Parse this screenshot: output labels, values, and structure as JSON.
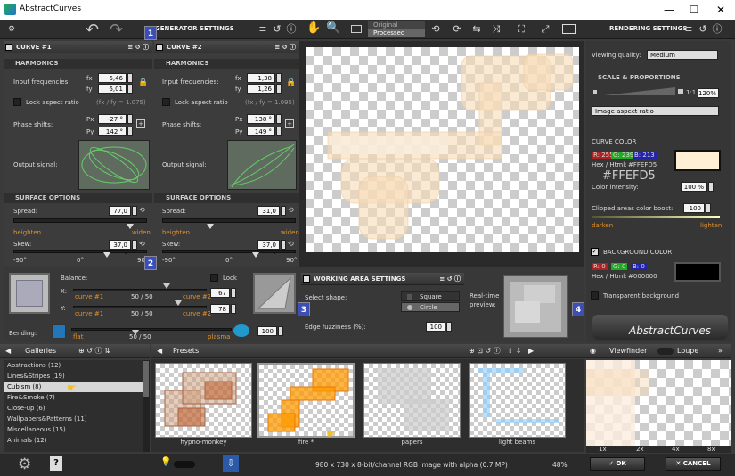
{
  "window": {
    "title": "AbstractCurves",
    "minimize": "—",
    "maximize": "☐",
    "close": "✕"
  },
  "toolbar": {
    "generator_settings": "GENERATOR SETTINGS",
    "original": "Original",
    "processed": "Processed",
    "rendering_settings": "RENDERING SETTINGS"
  },
  "curve1": {
    "title": "CURVE #1",
    "harmonics": "HARMONICS",
    "input_freq": "Input frequencies:",
    "fx_label": "fx",
    "fy_label": "fy",
    "fx": "6,46",
    "fy": "6,01",
    "lock_aspect": "Lock aspect ratio",
    "ratio": "(fx / fy = 1.075)",
    "phase_shifts": "Phase shifts:",
    "px_label": "Px",
    "py_label": "Py",
    "px": "-27 °",
    "py": "142 °",
    "output_signal": "Output signal:",
    "surface": "SURFACE OPTIONS",
    "spread": "Spread:",
    "spread_val": "77,0",
    "heighten": "heighten",
    "widen": "widen",
    "skew": "Skew:",
    "skew_val": "37,0 °",
    "t1": "-90°",
    "t2": "0°",
    "t3": "90°"
  },
  "curve2": {
    "title": "CURVE #2",
    "harmonics": "HARMONICS",
    "input_freq": "Input frequencies:",
    "fx_label": "fx",
    "fy_label": "fy",
    "fx": "1,38",
    "fy": "1,26",
    "lock_aspect": "Lock aspect ratio",
    "ratio": "(fx / fy = 1.095)",
    "phase_shifts": "Phase shifts:",
    "px_label": "Px",
    "py_label": "Py",
    "px": "138 °",
    "py": "149 °",
    "output_signal": "Output signal:",
    "surface": "SURFACE OPTIONS",
    "spread": "Spread:",
    "spread_val": "31,0",
    "heighten": "heighten",
    "widen": "widen",
    "skew": "Skew:",
    "skew_val": "37,0 °",
    "t1": "-90°",
    "t2": "0°",
    "t3": "90°"
  },
  "balance": {
    "label": "Balance:",
    "lock": "Lock",
    "x_label": "X:",
    "y_label": "Y:",
    "curve1": "curve #1",
    "curve2": "curve #2",
    "x_mid": "50 / 50",
    "y_mid": "50 / 50",
    "x_val": "67",
    "y_val": "78",
    "bending": "Bending:",
    "flat": "flat",
    "bend_mid": "50 / 50",
    "plasma": "plasma",
    "bend_val": "100"
  },
  "working": {
    "title": "WORKING AREA SETTINGS",
    "select_shape": "Select shape:",
    "square": "Square",
    "circle": "Circle",
    "edge": "Edge fuzziness (%):",
    "edge_val": "100",
    "realtime": "Real-time preview:"
  },
  "rendering": {
    "viewing_quality": "Viewing quality:",
    "quality_val": "Medium",
    "scale": "SCALE & PROPORTIONS",
    "one_to_one": "1:1",
    "zoom": "120%",
    "aspect": "Image aspect ratio",
    "curve_color": "CURVE COLOR",
    "r": "R: 255",
    "g": "G: 239",
    "b": "B: 213",
    "hex_label": "Hex / Html:",
    "hex": "#FFEFD5",
    "hex_big": "#FFEFD5",
    "intensity": "Color intensity:",
    "intensity_val": "100 %",
    "clipped": "Clipped areas color boost:",
    "clipped_val": "100",
    "darken": "darken",
    "lighten": "lighten",
    "bg_color": "BACKGROUND COLOR",
    "bg_r": "R: 0",
    "bg_g": "G: 0",
    "bg_b": "B: 0",
    "bg_hex_label": "Hex / Html:",
    "bg_hex": "#000000",
    "transparent": "Transparent background",
    "logo": "AbstractCurves"
  },
  "galleries": {
    "title": "Galleries",
    "items": [
      "Abstractions (12)",
      "Lines&Stripes (19)",
      "Cubism (8)",
      "Fire&Smoke (7)",
      "Close-up (6)",
      "Wallpapers&Patterns (11)",
      "Miscellaneous (15)",
      "Animals (12)"
    ]
  },
  "presets": {
    "title": "Presets",
    "items": [
      "hypno-monkey",
      "fire *",
      "papers",
      "light beams"
    ]
  },
  "viewfinder": {
    "title": "Viewfinder",
    "loupe": "Loupe",
    "zooms": [
      "1x",
      "2x",
      "4x",
      "8x"
    ]
  },
  "badges": [
    "1",
    "2",
    "3",
    "4"
  ],
  "status": {
    "info": "980 x 730 x 8-bit/channel RGB image with alpha  (0.7 MP)",
    "zoom": "48%",
    "ok": "OK",
    "cancel": "CANCEL"
  },
  "colors": {
    "curve": "#FFEFD5",
    "accent": "#e0902a",
    "badge": "#3b4fb7"
  }
}
